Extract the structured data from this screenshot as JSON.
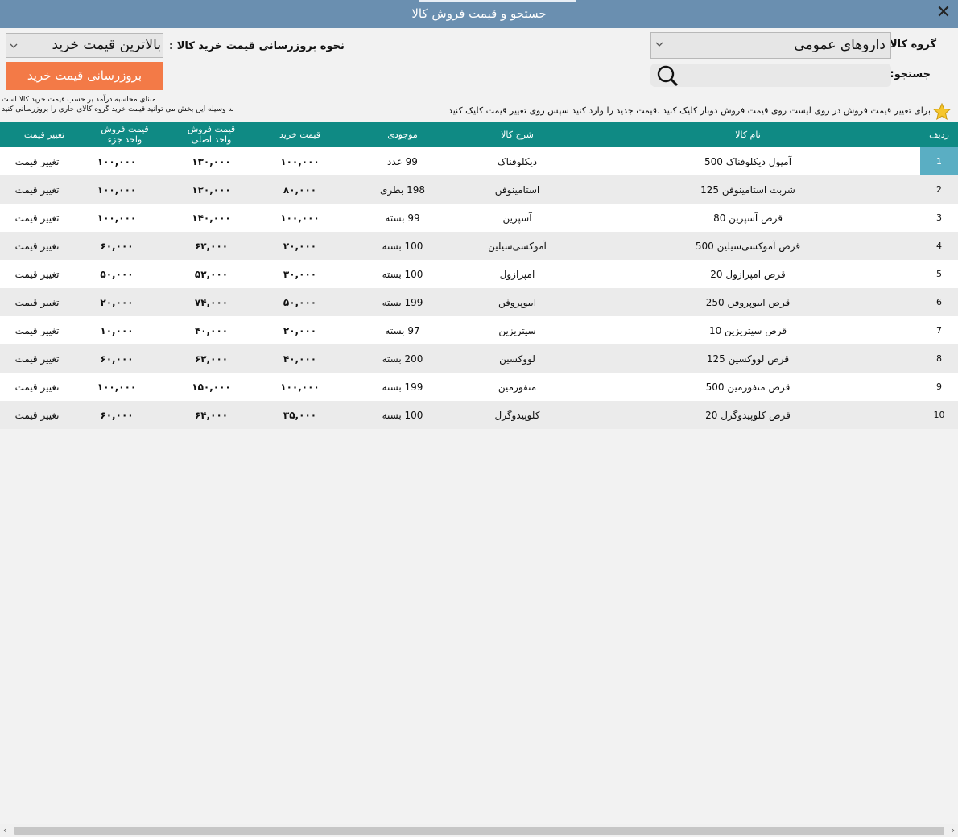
{
  "window": {
    "title": "جستجو و قیمت فروش کالا",
    "close_label": "✕"
  },
  "controls": {
    "group_label": "گروه کالا:",
    "group_value": "داروهای عمومی",
    "search_label": "جستجو:",
    "search_value": "",
    "update_mode_label": "نحوه بروزرسانی قیمت خرید کالا :",
    "update_mode_value": "بالاترین قیمت خرید",
    "update_button": "بروزرسانی قیمت خرید",
    "note_line1": "مبنای محاسبه درآمد بر حسب قیمت خرید کالا است",
    "note_line2": "به وسیله این بخش می توانید قیمت خرید گروه کالای جاری را بروزرسانی کنید",
    "hint": "برای تغییر قیمت فروش در روی لیست روی قیمت فروش دوبار کلیک کنید .قیمت جدید را وارد کنید سپس روی تغییر قیمت کلیک کنید"
  },
  "table": {
    "headers": {
      "row": "ردیف",
      "name": "نام کالا",
      "desc": "شرح کالا",
      "stock": "موجودی",
      "buy": "قیمت خرید",
      "sell_main_1": "قیمت فروش",
      "sell_main_2": "واحد اصلی",
      "sell_part_1": "قیمت فروش",
      "sell_part_2": "واحد جزء",
      "action": "تغییر قیمت"
    },
    "rows": [
      {
        "num": "1",
        "name": "آمپول دیکلوفناک 500",
        "desc": "دیکلوفناک",
        "stock": "99 عدد",
        "buy": "۱۰۰,۰۰۰",
        "sell_main": "۱۳۰,۰۰۰",
        "sell_part": "۱۰۰,۰۰۰",
        "action": "تغییر قیمت"
      },
      {
        "num": "2",
        "name": "شربت استامینوفن 125",
        "desc": "استامینوفن",
        "stock": "198 بطری",
        "buy": "۸۰,۰۰۰",
        "sell_main": "۱۲۰,۰۰۰",
        "sell_part": "۱۰۰,۰۰۰",
        "action": "تغییر قیمت"
      },
      {
        "num": "3",
        "name": "قرص آسپرین 80",
        "desc": "آسپرین",
        "stock": "99 بسته",
        "buy": "۱۰۰,۰۰۰",
        "sell_main": "۱۴۰,۰۰۰",
        "sell_part": "۱۰۰,۰۰۰",
        "action": "تغییر قیمت"
      },
      {
        "num": "4",
        "name": "قرص آموکسی‌سیلین 500",
        "desc": "آموکسی‌سیلین",
        "stock": "100 بسته",
        "buy": "۲۰,۰۰۰",
        "sell_main": "۶۲,۰۰۰",
        "sell_part": "۶۰,۰۰۰",
        "action": "تغییر قیمت"
      },
      {
        "num": "5",
        "name": "قرص امپرازول 20",
        "desc": "امپرازول",
        "stock": "100 بسته",
        "buy": "۳۰,۰۰۰",
        "sell_main": "۵۲,۰۰۰",
        "sell_part": "۵۰,۰۰۰",
        "action": "تغییر قیمت"
      },
      {
        "num": "6",
        "name": "قرص ایبوپروفن 250",
        "desc": "ایبوپروفن",
        "stock": "199 بسته",
        "buy": "۵۰,۰۰۰",
        "sell_main": "۷۴,۰۰۰",
        "sell_part": "۲۰,۰۰۰",
        "action": "تغییر قیمت"
      },
      {
        "num": "7",
        "name": "قرص سیتریزین 10",
        "desc": "سیتریزین",
        "stock": "97 بسته",
        "buy": "۲۰,۰۰۰",
        "sell_main": "۴۰,۰۰۰",
        "sell_part": "۱۰,۰۰۰",
        "action": "تغییر قیمت"
      },
      {
        "num": "8",
        "name": "قرص لووکسین 125",
        "desc": "لووکسین",
        "stock": "200 بسته",
        "buy": "۴۰,۰۰۰",
        "sell_main": "۶۲,۰۰۰",
        "sell_part": "۶۰,۰۰۰",
        "action": "تغییر قیمت"
      },
      {
        "num": "9",
        "name": "قرص متفورمین 500",
        "desc": "متفورمین",
        "stock": "199 بسته",
        "buy": "۱۰۰,۰۰۰",
        "sell_main": "۱۵۰,۰۰۰",
        "sell_part": "۱۰۰,۰۰۰",
        "action": "تغییر قیمت"
      },
      {
        "num": "10",
        "name": "قرص کلوپیدوگرل 20",
        "desc": "کلوپیدوگرل",
        "stock": "100 بسته",
        "buy": "۳۵,۰۰۰",
        "sell_main": "۶۴,۰۰۰",
        "sell_part": "۶۰,۰۰۰",
        "action": "تغییر قیمت"
      }
    ]
  },
  "colors": {
    "titlebar": "#6a8fb0",
    "header": "#0f8a84",
    "update_button": "#f37a47",
    "selected_row_number": "#5aaec3"
  },
  "icons": [
    "close-icon",
    "chevron-down-icon",
    "search-icon",
    "star-icon"
  ]
}
